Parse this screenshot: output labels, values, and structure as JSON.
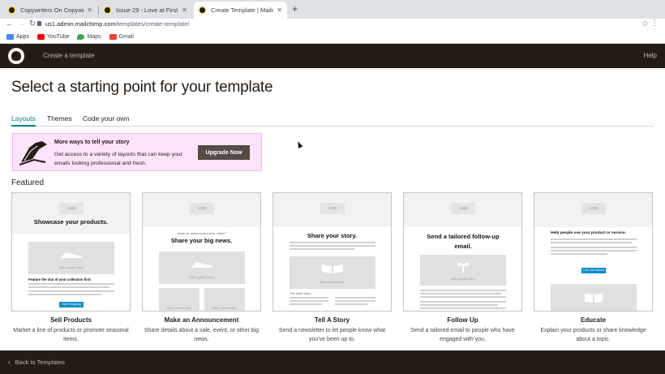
{
  "browser": {
    "tabs": [
      {
        "title": "Copywriters On Copywriting",
        "active": false
      },
      {
        "title": "Issue 29 - Love at First Write",
        "active": false
      },
      {
        "title": "Create Template | Mailchimp",
        "active": true
      }
    ],
    "url_host": "us1.admin.mailchimp.com",
    "url_path": "/templates/create-template/",
    "bookmarks": [
      {
        "label": "Apps",
        "icon": "apps-grid-icon",
        "color": "#4285f4"
      },
      {
        "label": "YouTube",
        "icon": "youtube-icon",
        "color": "#ff0000"
      },
      {
        "label": "Maps",
        "icon": "maps-pin-icon",
        "color": "#34a853"
      },
      {
        "label": "Gmail",
        "icon": "gmail-icon",
        "color": "#ea4335"
      }
    ]
  },
  "header": {
    "breadcrumb": "Create a template",
    "help": "Help"
  },
  "main": {
    "title": "Select a starting point for your template",
    "tabs": [
      "Layouts",
      "Themes",
      "Code your own"
    ],
    "promo": {
      "title": "More ways to tell your story",
      "text": "Get access to a variety of layouts that can keep your emails looking professional and fresh.",
      "button": "Upgrade Now"
    },
    "featured_label": "Featured",
    "cards": [
      {
        "title": "Sell Products",
        "desc": "Market a line of products or promote seasonal items.",
        "preview_heading": "Showcase your products.",
        "preview_sub": "Feature the star of your collection first.",
        "logo": "Logo",
        "photo": "Add a photo here.",
        "button": "Start Shopping"
      },
      {
        "title": "Make an Announcement",
        "desc": "Share details about a sale, event, or other big news.",
        "preview_kicker": "Have an announcement to make?",
        "preview_heading": "Share your big news.",
        "logo": "Logo",
        "photo": "Add a photo here."
      },
      {
        "title": "Tell A Story",
        "desc": "Send a newsletter to let people know what you've been up to.",
        "preview_heading": "Share your story.",
        "preview_sub": "The main story",
        "logo": "Logo",
        "photo": "Add a photo here."
      },
      {
        "title": "Follow Up",
        "desc": "Send a tailored email to people who have engaged with you.",
        "preview_heading": "Send a tailored follow-up email.",
        "logo": "Logo",
        "photo": "Add a photo here."
      },
      {
        "title": "Educate",
        "desc": "Explain your products or share knowledge about a topic.",
        "preview_heading": "Help people use your product or service.",
        "logo": "Logo",
        "button": "Let's Get Started"
      }
    ]
  },
  "footer": {
    "back": "Back to Templates"
  }
}
